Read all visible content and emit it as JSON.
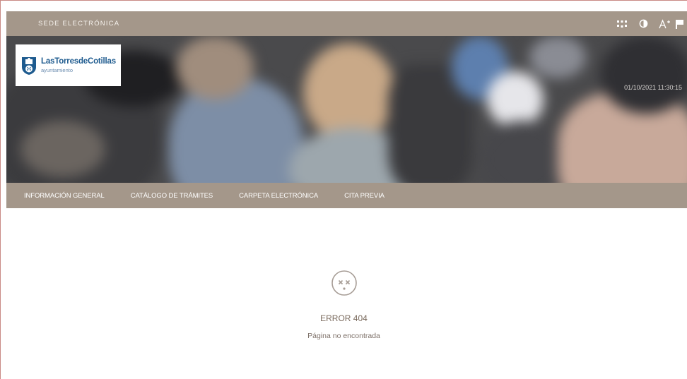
{
  "header": {
    "site_title": "SEDE ELECTRÓNICA",
    "tools": [
      {
        "name": "keyboard-shortcuts-icon"
      },
      {
        "name": "contrast-icon"
      },
      {
        "name": "font-size-icon"
      },
      {
        "name": "language-flag-icon"
      }
    ]
  },
  "hero": {
    "logo_name_bold_1": "Las",
    "logo_name_bold_2": "TorresdeCotillas",
    "logo_sub": "ayuntamiento",
    "datetime": "01/10/2021 11:30:15"
  },
  "nav": {
    "items": [
      {
        "label": "INFORMACIÓN GENERAL"
      },
      {
        "label": "CATÁLOGO DE TRÁMITES"
      },
      {
        "label": "CARPETA ELECTRÓNICA"
      },
      {
        "label": "CITA PREVIA"
      }
    ]
  },
  "error": {
    "code": "ERROR 404",
    "message": "Página no encontrada"
  },
  "colors": {
    "bar": "#a4978a",
    "logo_blue": "#1e5b8f",
    "error_text": "#7a6a5d"
  }
}
